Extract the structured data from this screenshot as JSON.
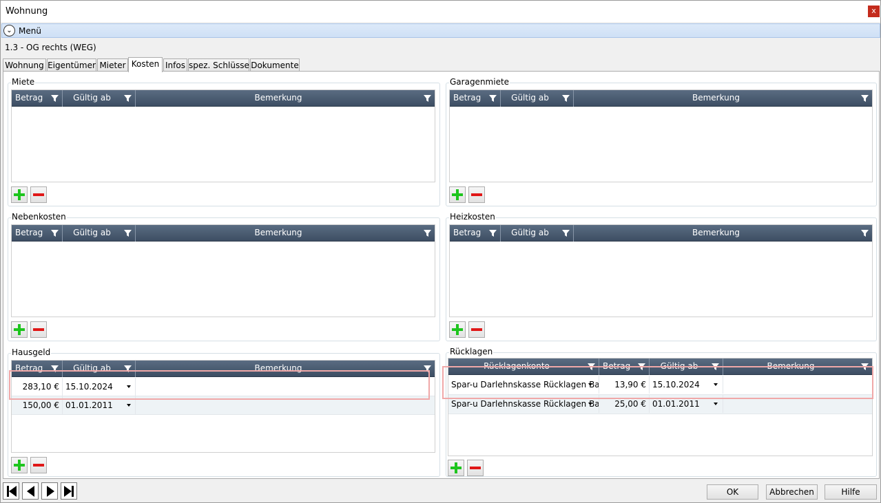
{
  "window": {
    "title": "Wohnung",
    "close_label": "x"
  },
  "menu": {
    "label": "Menü",
    "icon": "chevron-down-circle-icon"
  },
  "object_title": "1.3 - OG rechts (WEG)",
  "tabs": [
    {
      "label": "Wohnung"
    },
    {
      "label": "Eigentümer"
    },
    {
      "label": "Mieter"
    },
    {
      "label": "Kosten",
      "active": true
    },
    {
      "label": "Infos"
    },
    {
      "label": "spez. Schlüssel"
    },
    {
      "label": "Dokumente"
    }
  ],
  "groups": {
    "miete": {
      "title": "Miete",
      "columns": [
        "Betrag",
        "Gültig ab",
        "Bemerkung"
      ],
      "rows": []
    },
    "garagenmiete": {
      "title": "Garagenmiete",
      "columns": [
        "Betrag",
        "Gültig ab",
        "Bemerkung"
      ],
      "rows": []
    },
    "nebenkosten": {
      "title": "Nebenkosten",
      "columns": [
        "Betrag",
        "Gültig ab",
        "Bemerkung"
      ],
      "rows": []
    },
    "heizkosten": {
      "title": "Heizkosten",
      "columns": [
        "Betrag",
        "Gültig ab",
        "Bemerkung"
      ],
      "rows": []
    },
    "hausgeld": {
      "title": "Hausgeld",
      "columns": [
        "Betrag",
        "Gültig ab",
        "Bemerkung"
      ],
      "rows": [
        {
          "betrag": "283,10 €",
          "gueltig_ab": "15.10.2024",
          "bemerkung": ""
        },
        {
          "betrag": "150,00 €",
          "gueltig_ab": "01.01.2011",
          "bemerkung": ""
        }
      ]
    },
    "ruecklagen": {
      "title": "Rücklagen",
      "columns": [
        "Rücklagenkonto",
        "Betrag",
        "Gültig ab",
        "Bemerkung"
      ],
      "rows": [
        {
          "konto": "Spar-u Darlehnskasse Rücklagen Ba",
          "betrag": "13,90 €",
          "gueltig_ab": "15.10.2024",
          "bemerkung": ""
        },
        {
          "konto": "Spar-u Darlehnskasse Rücklagen Ba",
          "betrag": "25,00 €",
          "gueltig_ab": "01.01.2011",
          "bemerkung": ""
        }
      ]
    }
  },
  "colors": {
    "grid_header": "#46566b",
    "add_icon": "#1ec51e",
    "remove_icon": "#e01818",
    "highlight": "#f0a8a8"
  },
  "footer": {
    "ok_label": "OK",
    "cancel_label": "Abbrechen",
    "help_label": "Hilfe"
  }
}
